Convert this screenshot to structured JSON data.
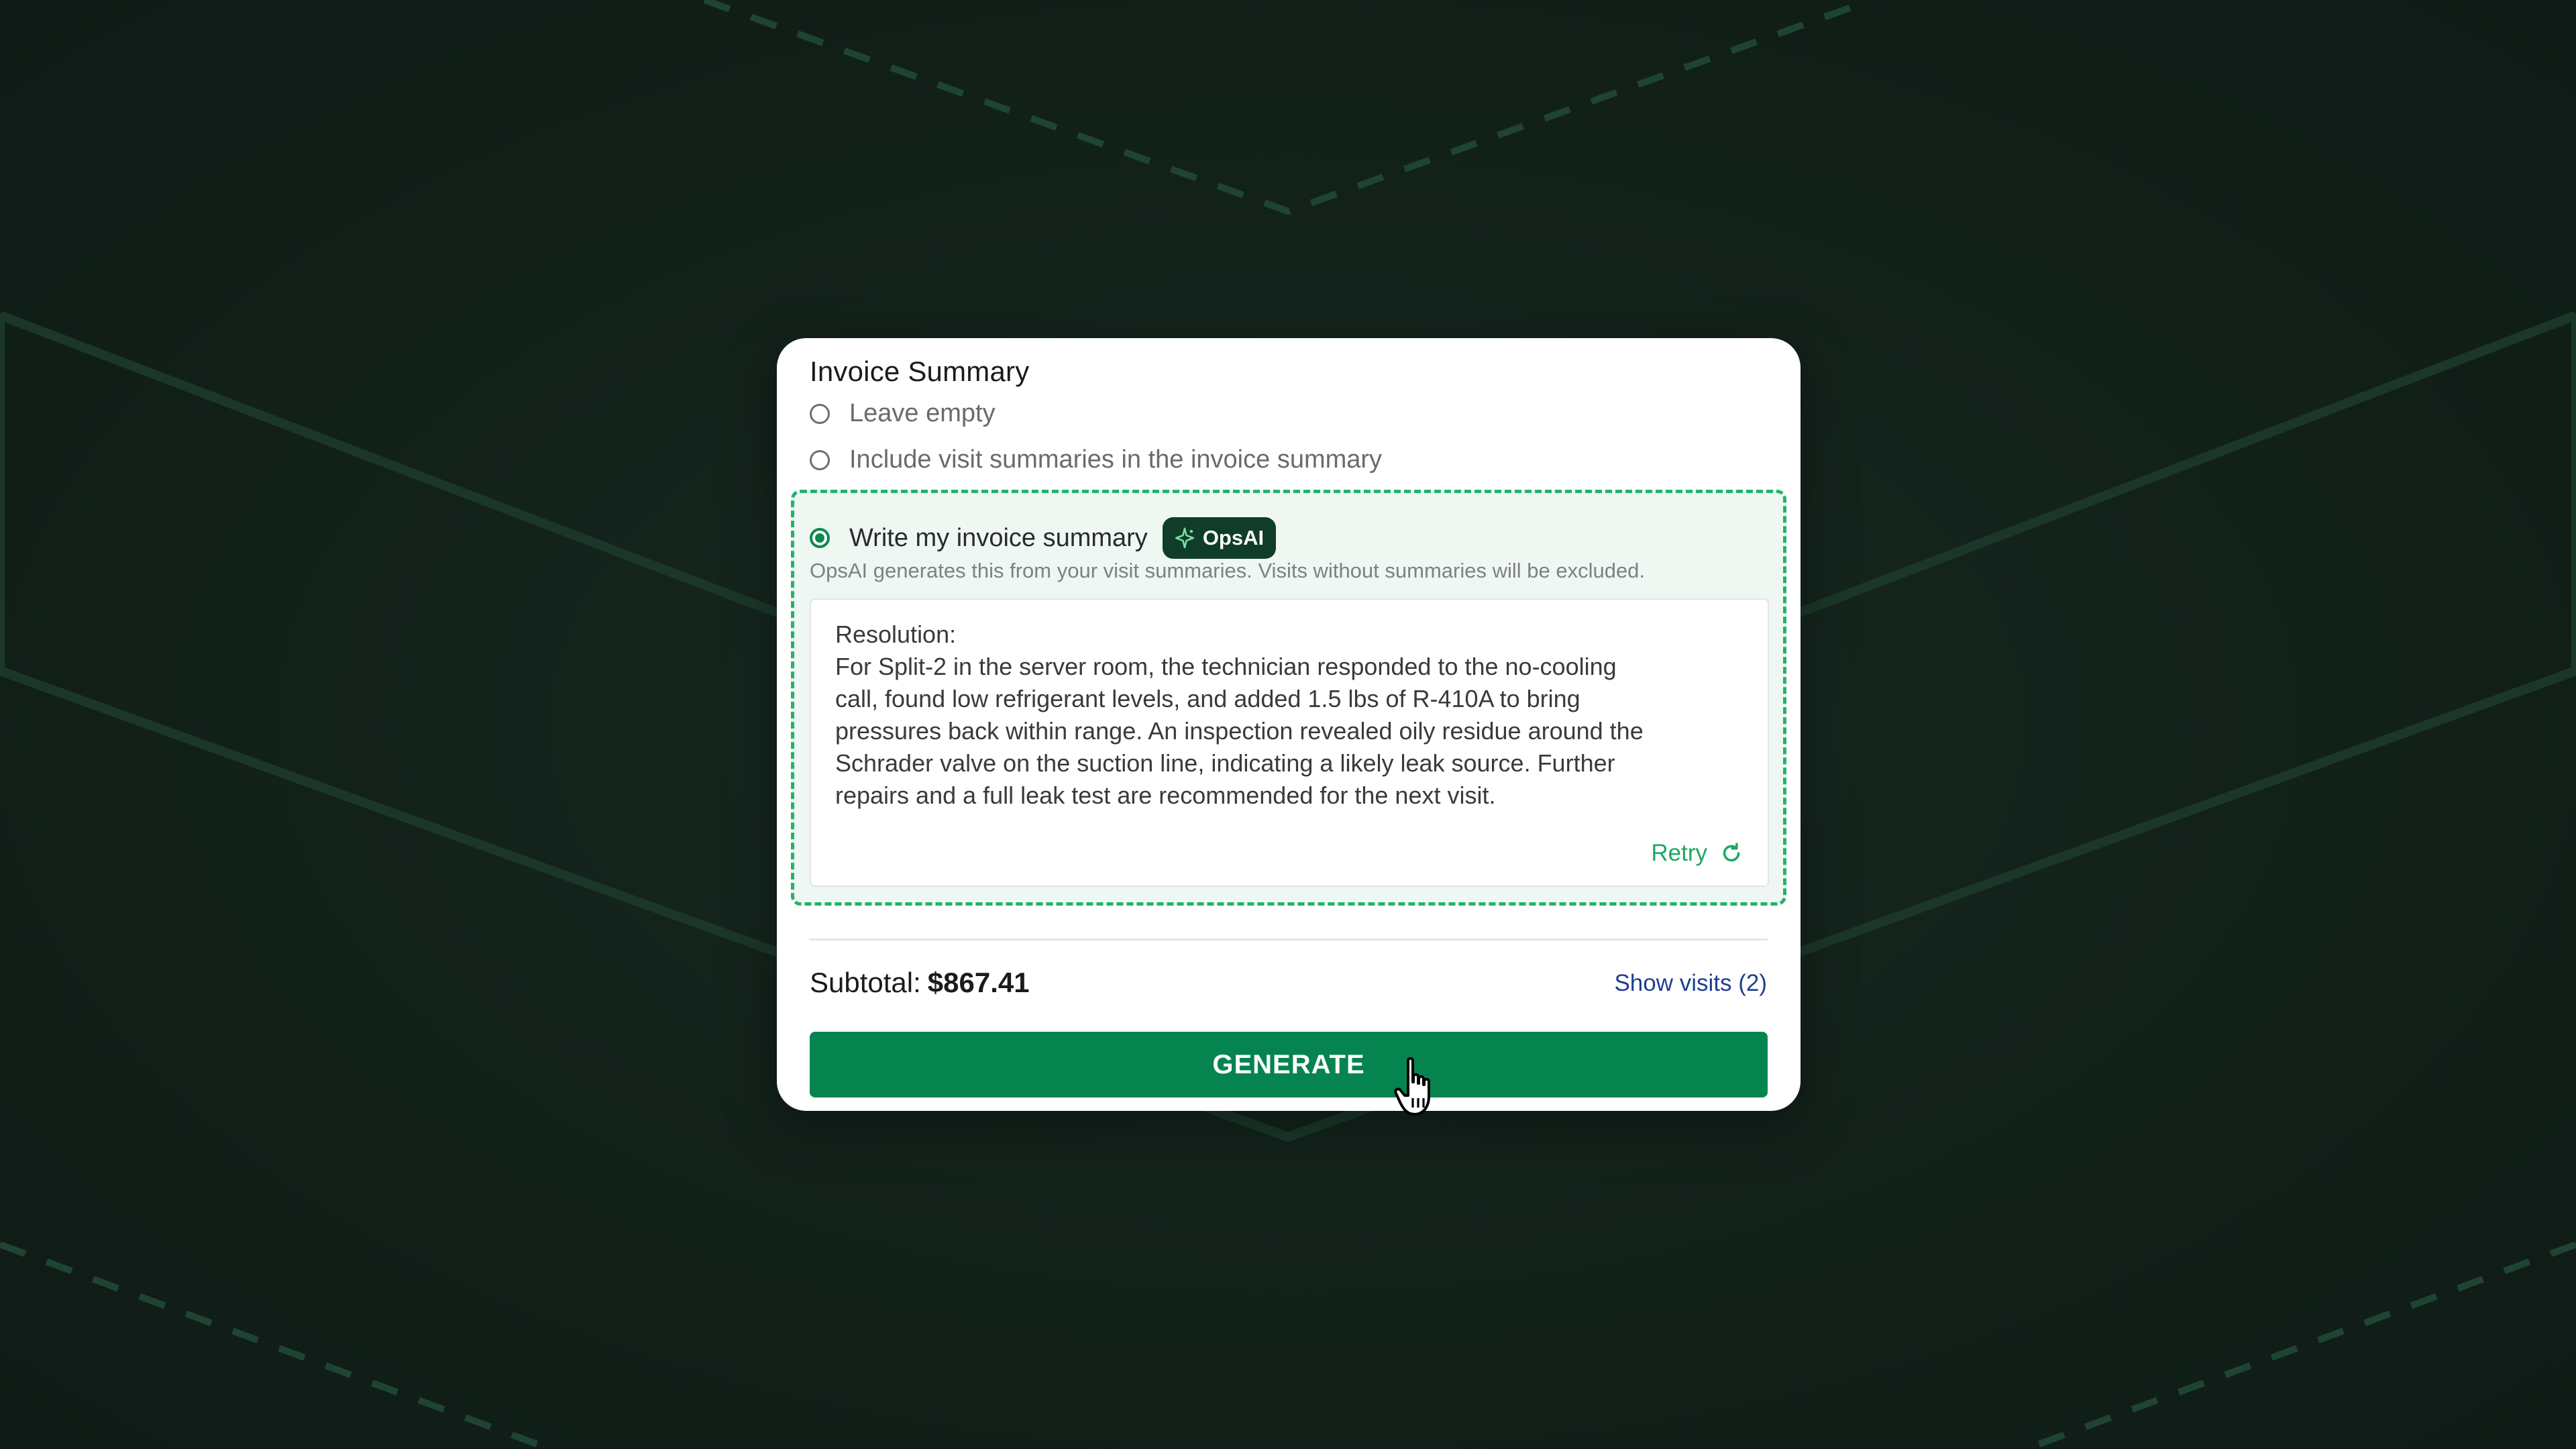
{
  "card": {
    "title": "Invoice Summary",
    "options": [
      {
        "label": "Leave empty",
        "selected": false
      },
      {
        "label": "Include visit summaries in the invoice summary",
        "selected": false
      },
      {
        "label": "Write my invoice summary",
        "selected": true
      }
    ],
    "badge": {
      "icon": "sparkle-icon",
      "label": "OpsAI"
    },
    "hint": "OpsAI generates this from your visit summaries. Visits without summaries will be excluded.",
    "summary": {
      "heading": "Resolution:",
      "lines": [
        "For Split-2 in the server room, the technician responded to the no-cooling",
        "call, found low refrigerant levels, and added 1.5 lbs of R-410A to bring",
        "pressures back within range. An inspection revealed oily residue around the",
        "Schrader valve on the suction line, indicating a likely leak source. Further",
        "repairs and a full leak test are recommended for the next visit."
      ]
    },
    "retry_label": "Retry",
    "retry_icon": "refresh-icon",
    "subtotal_label": "Subtotal:",
    "subtotal_value": "$867.41",
    "show_visits_label": "Show visits (2)",
    "generate_label": "GENERATE"
  },
  "colors": {
    "background": "#122019",
    "accent_green": "#068450",
    "dashed_border": "#22b36a",
    "badge_bg": "#0f3d2a",
    "link_blue": "#1f3f8f"
  },
  "cursor_icon": "hand-pointer-icon"
}
